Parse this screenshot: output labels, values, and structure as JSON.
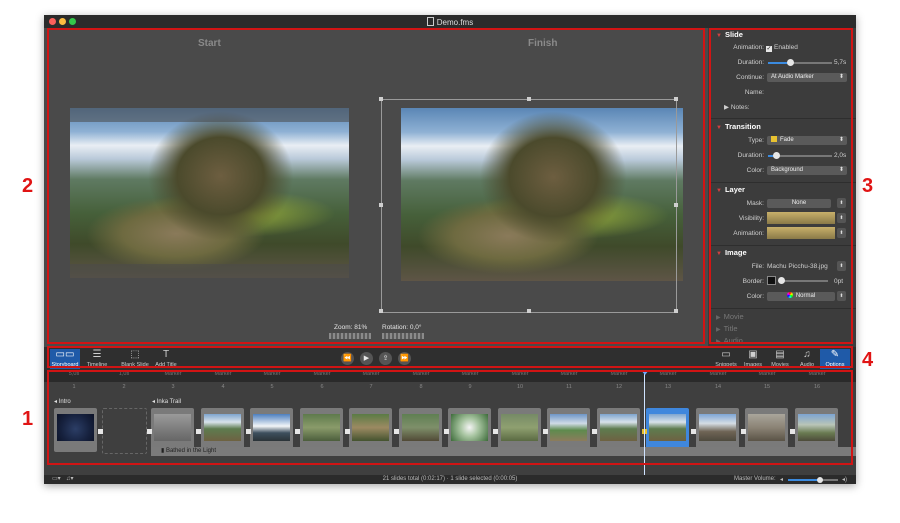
{
  "window": {
    "title": "Demo.fms"
  },
  "preview": {
    "start_label": "Start",
    "finish_label": "Finish",
    "zoom_label": "Zoom: 81%",
    "rotation_label": "Rotation: 0,0°"
  },
  "inspector": {
    "slide": {
      "title": "Slide",
      "animation_label": "Animation:",
      "enabled_label": "Enabled",
      "duration_label": "Duration:",
      "duration_value": "5,7s",
      "continue_label": "Continue:",
      "continue_value": "At Audio Marker",
      "name_label": "Name:",
      "notes_label": "Notes:"
    },
    "transition": {
      "title": "Transition",
      "type_label": "Type:",
      "type_value": "Fade",
      "duration_label": "Duration:",
      "duration_value": "2,0s",
      "color_label": "Color:",
      "color_value": "Background"
    },
    "layer": {
      "title": "Layer",
      "mask_label": "Mask:",
      "mask_value": "None",
      "visibility_label": "Visibility:",
      "animation_label": "Animation:"
    },
    "image": {
      "title": "Image",
      "file_label": "File:",
      "file_value": "Machu Picchu-38.jpg",
      "border_label": "Border:",
      "border_value": "0pt",
      "color_label": "Color:",
      "color_value": "Normal"
    },
    "collapsed": [
      "Movie",
      "Title",
      "Audio"
    ]
  },
  "toolbar": {
    "left": [
      {
        "label": "Storyboard",
        "icon": "storyboard-icon"
      },
      {
        "label": "Timeline",
        "icon": "timeline-icon"
      },
      {
        "label": "Blank Slide",
        "icon": "blank-slide-icon"
      },
      {
        "label": "Add Title",
        "icon": "add-title-icon"
      }
    ],
    "transport": {
      "rewind": "⏪",
      "play": "▶",
      "share": "⇪",
      "forward": "⏩"
    },
    "right": [
      {
        "label": "Snippets",
        "icon": "snippets-icon"
      },
      {
        "label": "Images",
        "icon": "images-icon"
      },
      {
        "label": "Movies",
        "icon": "movies-icon"
      },
      {
        "label": "Audio",
        "icon": "audio-icon"
      },
      {
        "label": "Options",
        "icon": "options-icon"
      }
    ]
  },
  "ruler": {
    "ticks": [
      "5,0s",
      "1,0s",
      "Marker",
      "Marker",
      "Marker",
      "Marker",
      "Marker",
      "Marker",
      "Marker",
      "Marker",
      "Marker",
      "Marker",
      "Marker",
      "Marker",
      "Marker",
      "Marker"
    ],
    "numbers": [
      "1",
      "2",
      "3",
      "4",
      "5",
      "6",
      "7",
      "8",
      "9",
      "10",
      "11",
      "12",
      "13",
      "14",
      "15",
      "16"
    ]
  },
  "storyboard": {
    "intro_label": "Intro",
    "group_label": "Inka Trail",
    "audio_label": "Bathed in the Light",
    "selected_index": 12
  },
  "status": {
    "summary": "21 slides total (0:02:17)  ·  1 slide selected (0:00:05)",
    "volume_label": "Master Volume:",
    "volume_level": 0.64
  },
  "callouts": [
    "1",
    "2",
    "3",
    "4"
  ],
  "colors": {
    "accent": "#3b8be0",
    "highlight": "#d11414",
    "selection": "#1f5aa8"
  }
}
